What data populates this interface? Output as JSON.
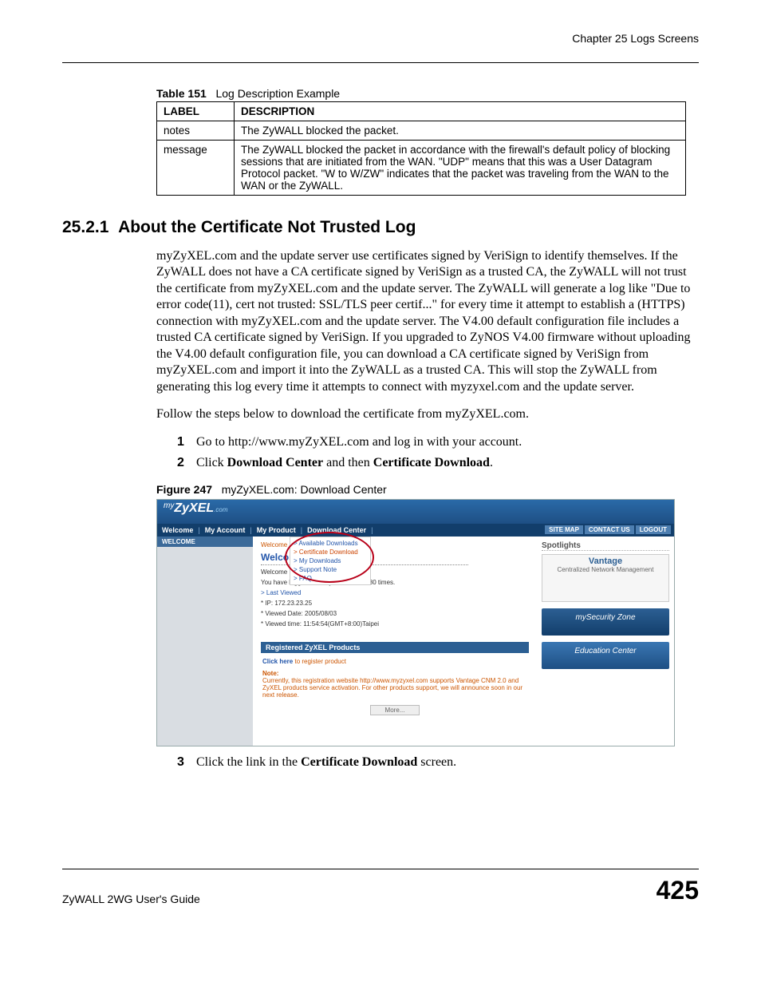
{
  "header": {
    "chapter": "Chapter 25 Logs Screens"
  },
  "table": {
    "number": "Table 151",
    "title": "Log Description Example",
    "columns": {
      "label": "LABEL",
      "description": "DESCRIPTION"
    },
    "rows": [
      {
        "label": "notes",
        "desc": "The ZyWALL blocked the packet."
      },
      {
        "label": "message",
        "desc": "The ZyWALL blocked the packet in accordance with the firewall's default policy of blocking sessions that are initiated from the WAN. \"UDP\" means that this was a User Datagram Protocol packet. \"W to W/ZW\" indicates that the packet was traveling from the WAN to the WAN or the ZyWALL."
      }
    ]
  },
  "section": {
    "number": "25.2.1",
    "title": "About the Certificate Not Trusted Log",
    "para1": "myZyXEL.com and the update server use certificates signed by VeriSign to identify themselves. If the ZyWALL does not have a CA certificate signed by VeriSign as a trusted CA, the ZyWALL will not trust the certificate from myZyXEL.com and the update server. The ZyWALL will generate a log like \"Due to error code(11), cert not trusted: SSL/TLS peer certif...\" for every time it attempt to establish a (HTTPS) connection with myZyXEL.com and the update server. The V4.00 default configuration file includes a trusted CA certificate signed by VeriSign. If you upgraded to ZyNOS V4.00 firmware without uploading the V4.00 default configuration file, you can download a CA certificate signed by VeriSign from myZyXEL.com and import it into the ZyWALL as a trusted CA. This will stop the ZyWALL from generating this log every time it attempts to connect with myzyxel.com and the update server.",
    "para2": "Follow the steps below to download the certificate from myZyXEL.com.",
    "steps": {
      "s1": "Go to http://www.myZyXEL.com and log in with your account.",
      "s2_pre": "Click ",
      "s2_b1": "Download Center",
      "s2_mid": " and then ",
      "s2_b2": "Certificate Download",
      "s2_post": ".",
      "s3_pre": "Click the link in the ",
      "s3_b1": "Certificate Download",
      "s3_post": " screen."
    }
  },
  "figure": {
    "number": "Figure 247",
    "title": "myZyXEL.com: Download Center",
    "logo_my": "my",
    "logo_main": "ZyXEL",
    "logo_com": ".com",
    "nav": {
      "welcome": "Welcome",
      "account": "My Account",
      "product": "My Product",
      "download": "Download Center"
    },
    "nav_right": {
      "sitemap": "SITE MAP",
      "contact": "CONTACT US",
      "logout": "LOGOUT"
    },
    "left_tab": "WELCOME",
    "dropdown": {
      "a": "> Available Downloads",
      "b": "> Certificate Download",
      "c": "> My Downloads",
      "d": "> Support Note",
      "e": "> FAQ"
    },
    "main": {
      "bread": "Welcome /",
      "title": "Welcom",
      "welcome_line": "Welcome",
      "logged": "You have logged in mcZyXEL.com for 80 times.",
      "last_viewed_h": "> Last Viewed",
      "ip": "* IP: 172.23.23.25",
      "date": "* Viewed Date: 2005/08/03",
      "time": "* Viewed time: 11:54:54(GMT+8:00)Taipei",
      "reg_header": "Registered ZyXEL Products",
      "reg_click_b": "Click here",
      "reg_click_post": " to register product",
      "note_h": "Note:",
      "note_body": "Currently, this registration website http://www.myzyxel.com supports Vantage CNM 2.0 and ZyXEL products service activation. For other products support, we will announce soon in our next release.",
      "more": "More..."
    },
    "right": {
      "spot": "Spotlights",
      "tile1a": "Vantage",
      "tile1b": "Centralized Network Management",
      "tile2": "mySecurity Zone",
      "tile3": "Education Center"
    }
  },
  "footer": {
    "guide": "ZyWALL 2WG User's Guide",
    "page": "425"
  }
}
